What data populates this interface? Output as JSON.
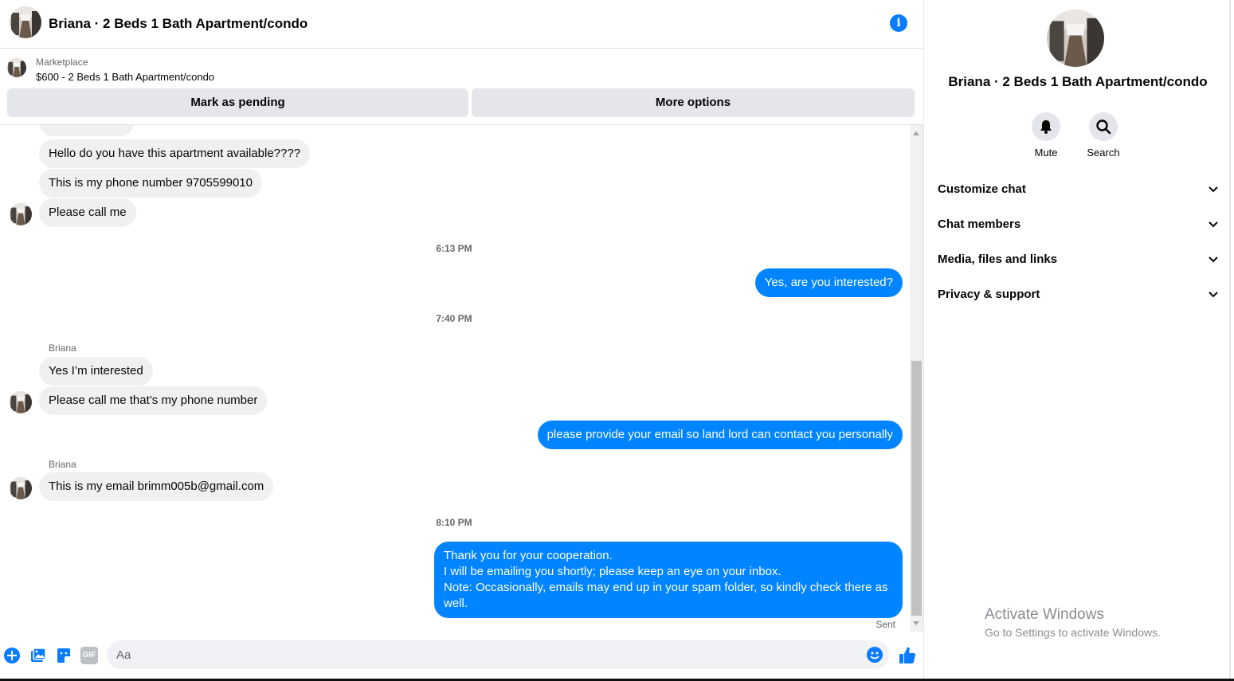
{
  "header": {
    "title": "Briana · 2 Beds 1 Bath Apartment/condo",
    "info_icon": "info-icon"
  },
  "marketplace": {
    "label": "Marketplace",
    "listing": "$600 - 2 Beds 1 Bath Apartment/condo",
    "mark_pending": "Mark as pending",
    "more_options": "More options"
  },
  "messages": {
    "m1": "Hello do you have this apartment available????",
    "m2": "This is my phone number 9705599010",
    "m3": "Please call me",
    "ts1": "6:13 PM",
    "m4": "Yes, are you interested?",
    "ts2": "7:40 PM",
    "sender1": "Briana",
    "m5": "Yes I’m interested",
    "m6": "Please call me that’s my phone number",
    "m7": "please provide your email so land lord can contact you personally",
    "sender2": "Briana",
    "m8": "This is my email brimm005b@gmail.com",
    "ts3": "8:10 PM",
    "m9_line1": "Thank you for your cooperation.",
    "m9_line2": "I will be emailing you shortly; please keep an eye on your inbox.",
    "m9_line3": "Note: Occasionally, emails may end up in your spam folder, so kindly check there as",
    "m9_line4": "well.",
    "status": "Sent"
  },
  "composer": {
    "placeholder": "Aa",
    "icons": [
      "plus-icon",
      "photo-icon",
      "sticker-icon",
      "gif-icon",
      "emoji-icon",
      "like-icon"
    ],
    "gif_label": "GIF"
  },
  "sidebar": {
    "name": "Briana · 2 Beds 1 Bath Apartment/condo",
    "mute": "Mute",
    "search": "Search",
    "sections": [
      "Customize chat",
      "Chat members",
      "Media, files and links",
      "Privacy & support"
    ]
  },
  "watermark": {
    "title": "Activate Windows",
    "subtitle": "Go to Settings to activate Windows."
  },
  "colors": {
    "accent": "#0084ff",
    "incoming": "#f0f0f0",
    "button": "#e4e6eb"
  }
}
